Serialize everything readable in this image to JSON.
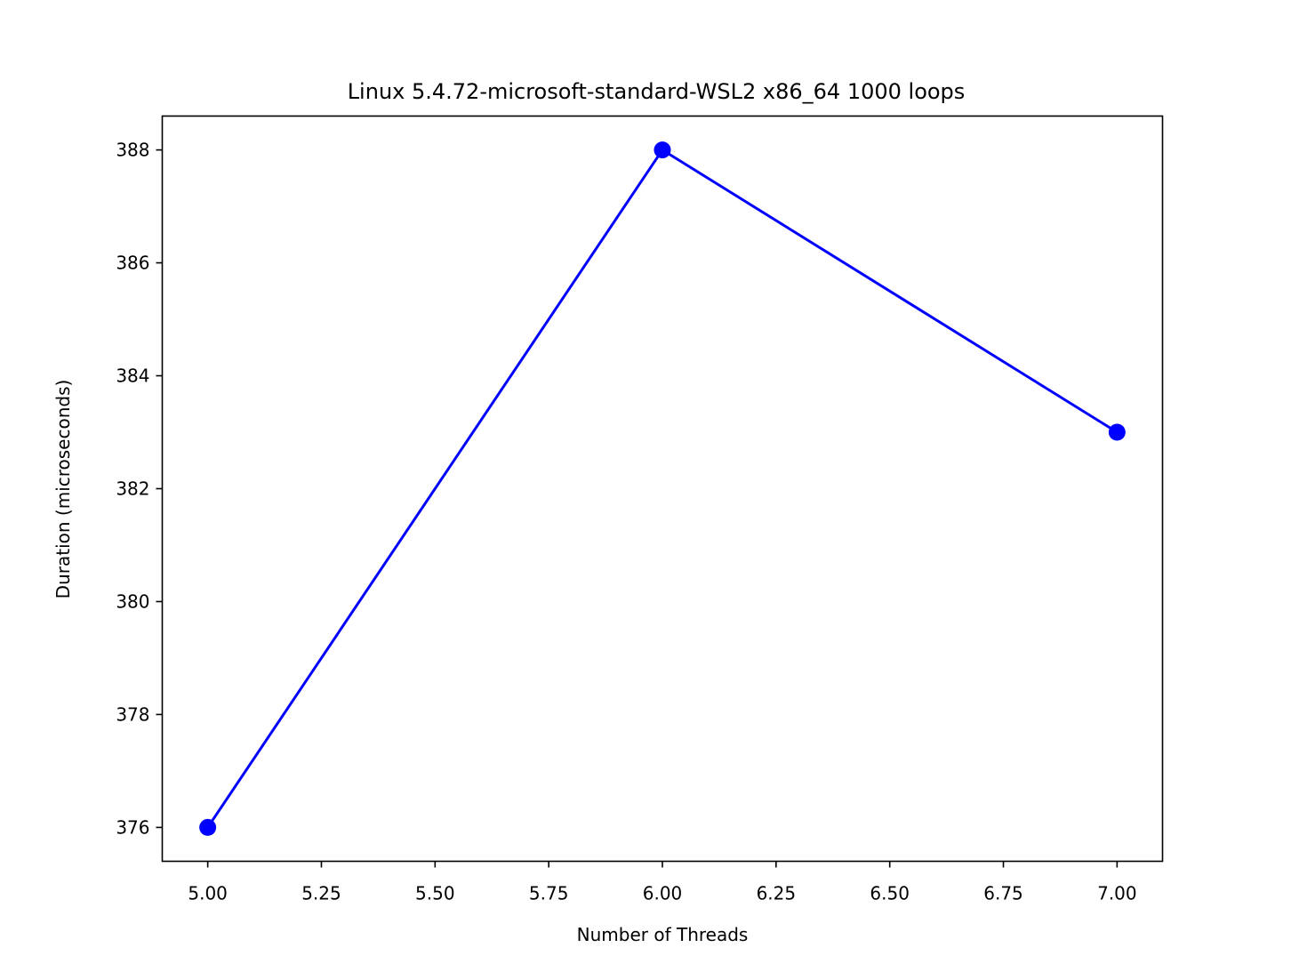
{
  "chart_data": {
    "type": "line",
    "title": "Linux 5.4.72-microsoft-standard-WSL2 x86_64 1000 loops",
    "xlabel": "Number of Threads",
    "ylabel": "Duration (microseconds)",
    "xlim": [
      4.9,
      7.1
    ],
    "ylim": [
      375.4,
      388.6
    ],
    "x_ticks": [
      5.0,
      5.25,
      5.5,
      5.75,
      6.0,
      6.25,
      6.5,
      6.75,
      7.0
    ],
    "x_tick_labels": [
      "5.00",
      "5.25",
      "5.50",
      "5.75",
      "6.00",
      "6.25",
      "6.50",
      "6.75",
      "7.00"
    ],
    "y_ticks": [
      376,
      378,
      380,
      382,
      384,
      386,
      388
    ],
    "y_tick_labels": [
      "376",
      "378",
      "380",
      "382",
      "384",
      "386",
      "388"
    ],
    "grid": false,
    "series": [
      {
        "x": [
          5,
          6,
          7
        ],
        "y": [
          376,
          388,
          383
        ],
        "color": "#0000ff",
        "marker": "circle"
      }
    ]
  }
}
